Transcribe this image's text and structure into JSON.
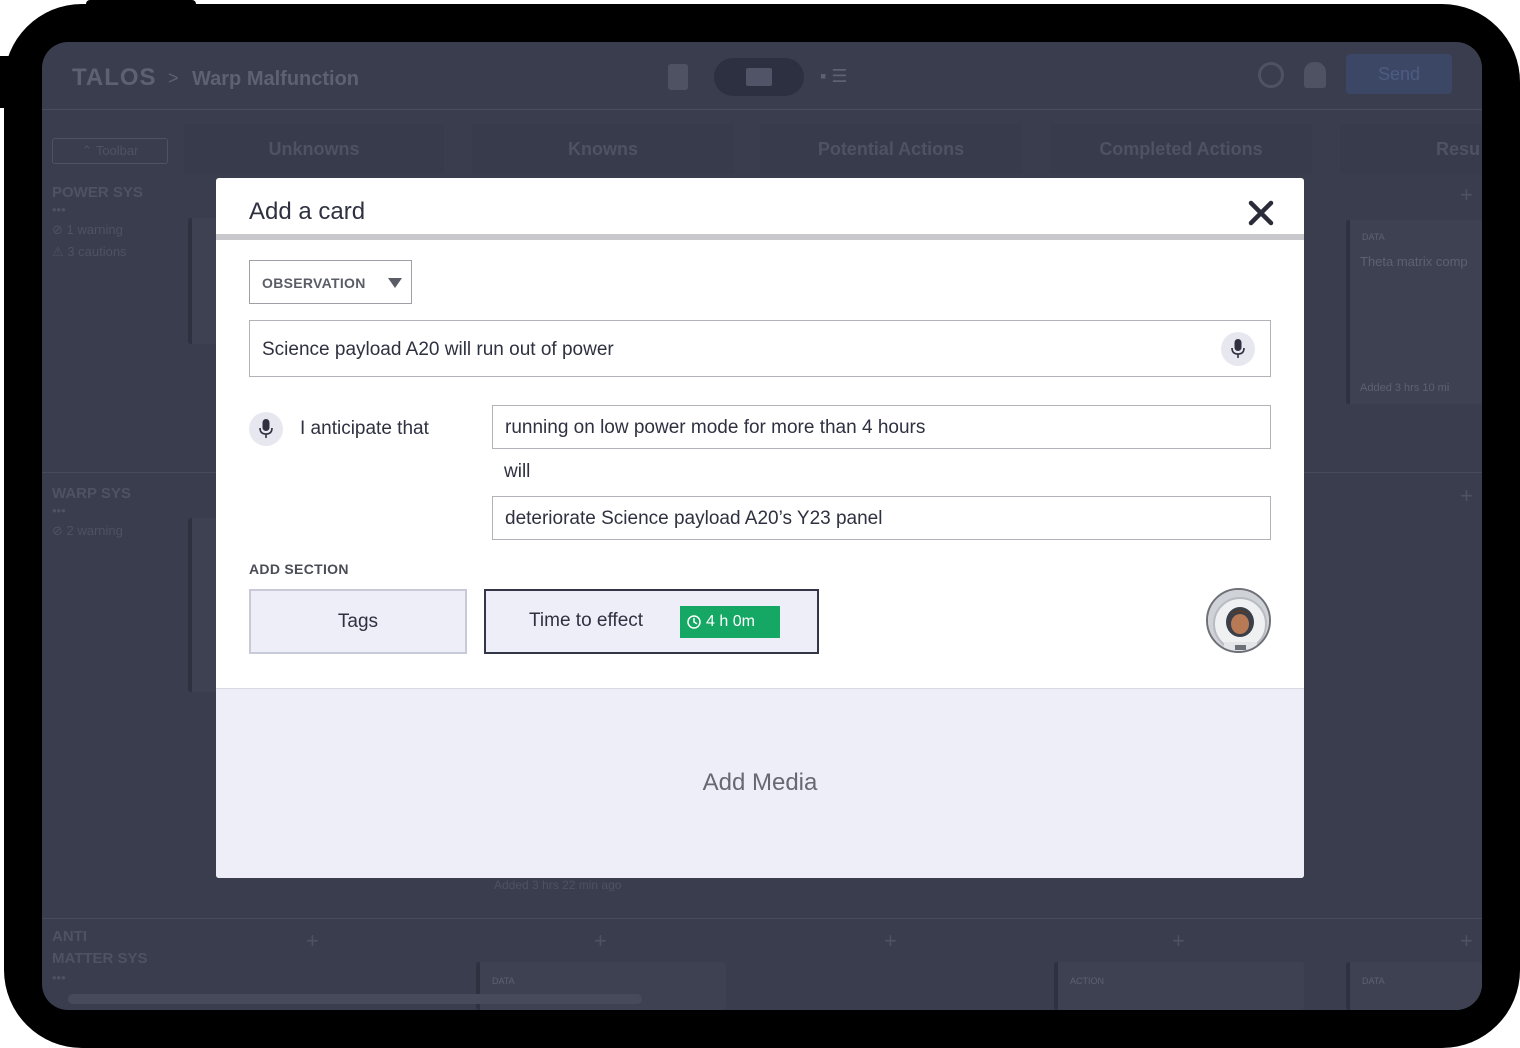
{
  "app": {
    "logo": "TALOS",
    "breadcrumb_separator": ">",
    "breadcrumb": "Warp Malfunction",
    "send_label": "Send",
    "toolbar_label": "Toolbar",
    "columns": [
      "Unknowns",
      "Knowns",
      "Potential Actions",
      "Completed Actions",
      "Resu"
    ],
    "rows": [
      {
        "label": "POWER SYS",
        "dots": "•••",
        "warnings": "1 warning",
        "cautions": "3 cautions"
      },
      {
        "label": "WARP SYS",
        "dots": "•••",
        "warnings": "2 warning"
      },
      {
        "label": "ANTI MATTER SYS",
        "dots": "•••"
      }
    ],
    "bg_card_text": "Theta matrix comp",
    "bg_card_meta": "Added 3 hrs 10 mi",
    "bg_card_meta2": "Added 3 hrs 22 min ago",
    "bg_card_kind_data": "DATA",
    "bg_card_kind_action": "ACTION",
    "plus": "+"
  },
  "modal": {
    "title": "Add a card",
    "card_type": "OBSERVATION",
    "title_value": "Science payload A20 will run out of power",
    "anticipate_label": "I anticipate that",
    "condition_value": "running on low power mode for more than 4 hours",
    "will_label": "will",
    "effect_value": "deteriorate Science payload A20’s Y23 panel",
    "add_section_label": "ADD SECTION",
    "tags_label": "Tags",
    "time_to_effect_label": "Time to effect",
    "time_to_effect_value": "4 h 0m",
    "add_media_label": "Add Media"
  },
  "colors": {
    "overlay": "#3a3d4d",
    "badge_green": "#15a864",
    "section_bg": "#eeeef8",
    "text_dark": "#2f3140"
  },
  "icons": [
    "close-icon",
    "microphone-icon",
    "clock-icon",
    "chevron-down-icon",
    "history-icon",
    "bell-icon",
    "clipboard-icon",
    "grid-icon",
    "list-icon"
  ]
}
